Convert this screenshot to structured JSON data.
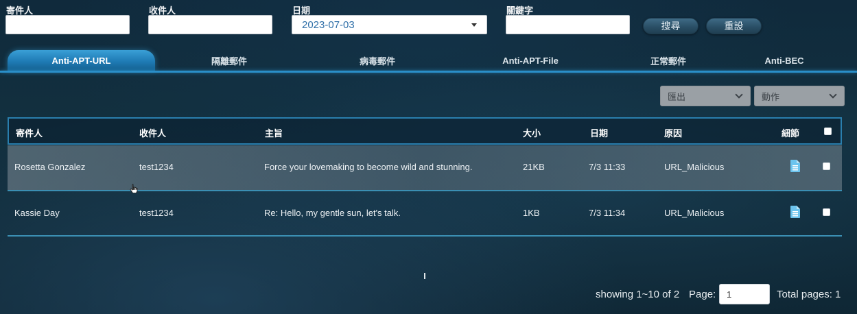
{
  "filters": {
    "sender_label": "寄件人",
    "recipient_label": "收件人",
    "date_label": "日期",
    "date_value": "2023-07-03",
    "keyword_label": "關鍵字",
    "sender_value": "",
    "recipient_value": "",
    "keyword_value": ""
  },
  "buttons": {
    "search": "搜尋",
    "reset": "重設"
  },
  "tabs": [
    {
      "label": "Anti-APT-URL",
      "active": true
    },
    {
      "label": "隔離郵件",
      "active": false
    },
    {
      "label": "病毒郵件",
      "active": false
    },
    {
      "label": "Anti-APT-File",
      "active": false
    },
    {
      "label": "正常郵件",
      "active": false
    },
    {
      "label": "Anti-BEC",
      "active": false
    }
  ],
  "toolbar": {
    "export_label": "匯出",
    "action_label": "動作"
  },
  "table": {
    "headers": {
      "sender": "寄件人",
      "recipient": "收件人",
      "subject": "主旨",
      "size": "大小",
      "date": "日期",
      "reason": "原因",
      "details": "細節"
    },
    "rows": [
      {
        "sender": "Rosetta Gonzalez",
        "recipient": "test1234",
        "subject": "Force your lovemaking to become wild and stunning.",
        "size": "21KB",
        "date": "7/3 11:33",
        "reason": "URL_Malicious"
      },
      {
        "sender": "Kassie Day",
        "recipient": "test1234",
        "subject": "Re: Hello, my gentle sun, let's talk.",
        "size": "1KB",
        "date": "7/3 11:34",
        "reason": "URL_Malicious"
      }
    ]
  },
  "pager": {
    "showing": "showing 1~10 of 2",
    "page_label": "Page:",
    "page_value": "1",
    "total_pages": "Total pages: 1"
  },
  "icons": {
    "details": "document-icon",
    "cursor": "mouse-pointer-icon"
  },
  "colors": {
    "accent": "#2a8fc9",
    "active_tab": "#1f7bb5",
    "date_text": "#2f6fa8",
    "doc_icon": "#6cc4ee"
  }
}
